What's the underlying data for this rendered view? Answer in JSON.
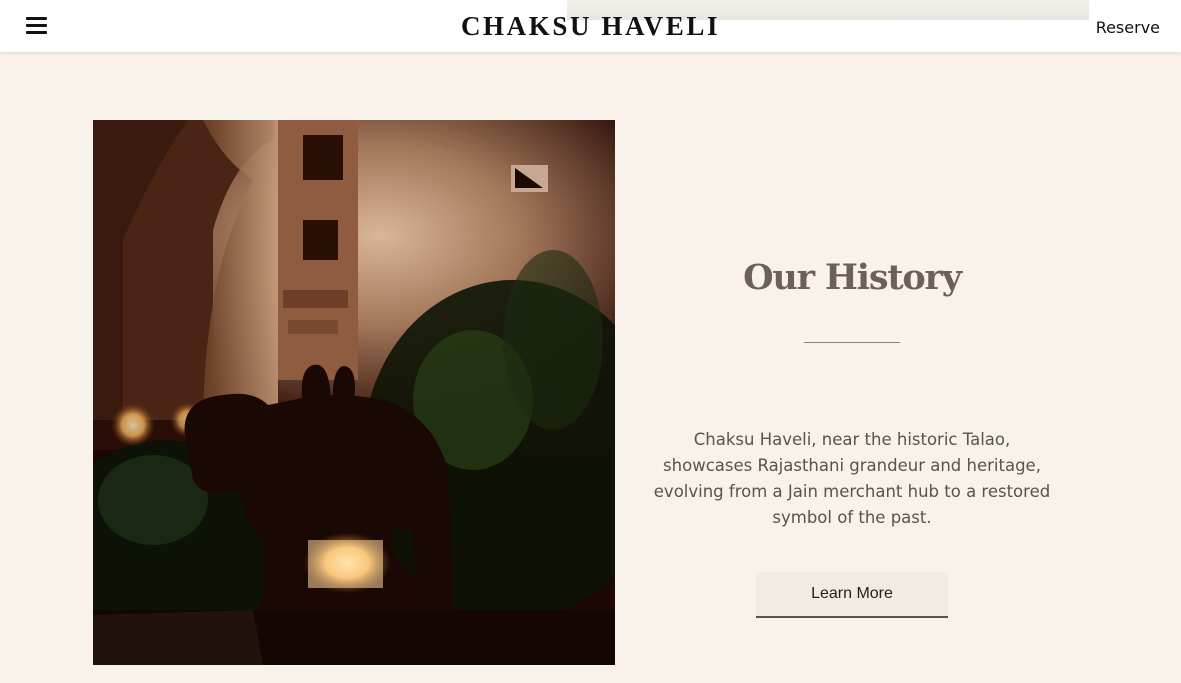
{
  "header": {
    "brand": "CHAKSU HAVELI",
    "reserve_label": "Reserve",
    "menu_icon": "hamburger-menu-icon"
  },
  "history": {
    "title": "Our History",
    "description": "Chaksu Haveli, near the historic Talao, showcases Rajasthani grandeur and heritage, evolving from a Jain merchant hub to a restored symbol of the past.",
    "button_label": "Learn More",
    "image_subject": "Night courtyard of the haveli with an illuminated stone elephant sculpture carrying riders, arched wall and garden plants"
  },
  "colors": {
    "page_background": "#f9f2ea",
    "header_background": "#ffffff",
    "title_color": "#6b6157",
    "text_color": "#5a524b",
    "button_background": "#f1ebe1"
  }
}
